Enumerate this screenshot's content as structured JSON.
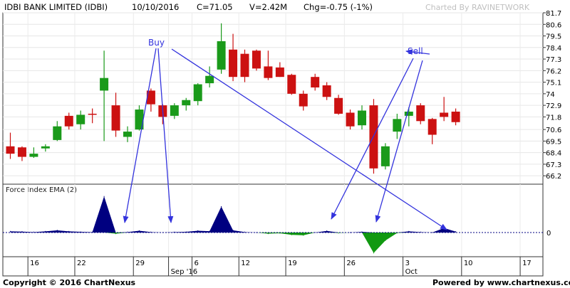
{
  "header": {
    "symbol": "IDBI BANK LIMITED (IDBI)",
    "date": "10/10/2016",
    "close": "C=71.05",
    "volume": "V=2.42M",
    "change": "Chg=-0.75 (-1%)",
    "charted_by": "Charted By RAVINETWORK"
  },
  "footer": {
    "copyright": "Copyright © 2016 ChartNexus",
    "powered": "Powered by www.chartnexus.com"
  },
  "colors": {
    "up": "#1a9a1a",
    "down": "#cc1111",
    "force_pos": "#000080",
    "force_neg": "#119911",
    "annotation": "#3333dd"
  },
  "chart_data": [
    {
      "type": "candlestick",
      "title": "IDBI BANK LIMITED (IDBI)",
      "ylim": [
        65.4,
        81.7
      ],
      "yticks": [
        81.7,
        80.6,
        79.5,
        78.4,
        77.3,
        76.2,
        75.1,
        74,
        72.9,
        71.8,
        70.6,
        69.5,
        68.4,
        67.3,
        66.2
      ],
      "xticks": [
        {
          "label": "16",
          "index": 1.5
        },
        {
          "label": "22",
          "index": 5.5
        },
        {
          "label": "29",
          "index": 10.5
        },
        {
          "label": "Sep '16",
          "index": 13.5
        },
        {
          "label": "6",
          "index": 15.5
        },
        {
          "label": "12",
          "index": 19.5
        },
        {
          "label": "19",
          "index": 23.5
        },
        {
          "label": "26",
          "index": 28.5
        },
        {
          "label": "3",
          "index": 33.5
        },
        {
          "label": "Oct",
          "index": 33.5
        },
        {
          "label": "10",
          "index": 38.5
        },
        {
          "label": "17",
          "index": 43.5
        }
      ],
      "candles": [
        {
          "o": 69.0,
          "h": 70.3,
          "l": 67.8,
          "c": 68.3
        },
        {
          "o": 68.9,
          "h": 69.0,
          "l": 67.6,
          "c": 68.0
        },
        {
          "o": 68.0,
          "h": 68.9,
          "l": 67.9,
          "c": 68.3
        },
        {
          "o": 68.8,
          "h": 69.2,
          "l": 68.5,
          "c": 69.0
        },
        {
          "o": 69.6,
          "h": 71.4,
          "l": 69.5,
          "c": 70.9
        },
        {
          "o": 71.9,
          "h": 72.2,
          "l": 70.6,
          "c": 70.9
        },
        {
          "o": 71.1,
          "h": 72.4,
          "l": 70.6,
          "c": 72.0
        },
        {
          "o": 72.1,
          "h": 72.6,
          "l": 71.2,
          "c": 72.0
        },
        {
          "o": 74.3,
          "h": 78.1,
          "l": 69.5,
          "c": 75.5
        },
        {
          "o": 72.9,
          "h": 74.1,
          "l": 69.9,
          "c": 70.5
        },
        {
          "o": 69.9,
          "h": 70.9,
          "l": 69.4,
          "c": 70.4
        },
        {
          "o": 70.6,
          "h": 72.9,
          "l": 70.5,
          "c": 72.5
        },
        {
          "o": 74.3,
          "h": 74.5,
          "l": 72.3,
          "c": 73.0
        },
        {
          "o": 72.9,
          "h": 73.0,
          "l": 71.1,
          "c": 71.8
        },
        {
          "o": 71.9,
          "h": 73.1,
          "l": 71.6,
          "c": 72.9
        },
        {
          "o": 72.9,
          "h": 73.6,
          "l": 72.4,
          "c": 73.4
        },
        {
          "o": 73.3,
          "h": 75.0,
          "l": 72.9,
          "c": 74.9
        },
        {
          "o": 75.0,
          "h": 76.6,
          "l": 74.6,
          "c": 75.7
        },
        {
          "o": 76.3,
          "h": 80.7,
          "l": 75.9,
          "c": 79.0
        },
        {
          "o": 78.2,
          "h": 79.7,
          "l": 75.2,
          "c": 75.6
        },
        {
          "o": 77.8,
          "h": 78.2,
          "l": 75.1,
          "c": 75.6
        },
        {
          "o": 78.1,
          "h": 78.2,
          "l": 76.2,
          "c": 76.4
        },
        {
          "o": 76.6,
          "h": 78.1,
          "l": 75.3,
          "c": 75.5
        },
        {
          "o": 76.5,
          "h": 77.0,
          "l": 75.6,
          "c": 75.6
        },
        {
          "o": 75.8,
          "h": 75.9,
          "l": 73.9,
          "c": 74.0
        },
        {
          "o": 74.0,
          "h": 74.3,
          "l": 72.4,
          "c": 72.8
        },
        {
          "o": 75.6,
          "h": 75.9,
          "l": 74.3,
          "c": 74.6
        },
        {
          "o": 74.8,
          "h": 75.1,
          "l": 73.4,
          "c": 73.7
        },
        {
          "o": 73.6,
          "h": 73.9,
          "l": 72.0,
          "c": 72.1
        },
        {
          "o": 72.2,
          "h": 72.5,
          "l": 70.6,
          "c": 70.9
        },
        {
          "o": 71.0,
          "h": 72.9,
          "l": 70.6,
          "c": 72.4
        },
        {
          "o": 72.9,
          "h": 73.5,
          "l": 66.4,
          "c": 66.9
        },
        {
          "o": 67.1,
          "h": 69.3,
          "l": 66.8,
          "c": 69.0
        },
        {
          "o": 70.4,
          "h": 72.1,
          "l": 69.7,
          "c": 71.6
        },
        {
          "o": 71.9,
          "h": 72.7,
          "l": 70.9,
          "c": 72.3
        },
        {
          "o": 72.9,
          "h": 73.1,
          "l": 71.1,
          "c": 71.4
        },
        {
          "o": 71.6,
          "h": 71.7,
          "l": 69.2,
          "c": 70.1
        },
        {
          "o": 72.2,
          "h": 73.7,
          "l": 71.4,
          "c": 71.8
        },
        {
          "o": 72.3,
          "h": 72.6,
          "l": 71.0,
          "c": 71.3
        }
      ]
    },
    {
      "type": "area",
      "title": "Force Index EMA (2)",
      "ylim": [
        -1.0,
        1.7
      ],
      "yticks": [
        0
      ],
      "values": [
        0.05,
        0.04,
        0.02,
        0.05,
        0.1,
        0.05,
        0.03,
        0.02,
        1.6,
        -0.05,
        0.02,
        0.08,
        0.02,
        0.0,
        0.02,
        0.03,
        0.08,
        0.06,
        1.15,
        0.1,
        0.02,
        0.0,
        -0.05,
        -0.03,
        -0.1,
        -0.12,
        0.0,
        0.07,
        -0.02,
        0.0,
        0.03,
        -0.9,
        -0.35,
        -0.02,
        0.05,
        0.02,
        0.0,
        0.2,
        0.04
      ]
    }
  ],
  "annotations": {
    "buy_label": "Buy",
    "sell_label": "Sell"
  },
  "force_label": "Force Index EMA (2)",
  "zero_label": "0"
}
